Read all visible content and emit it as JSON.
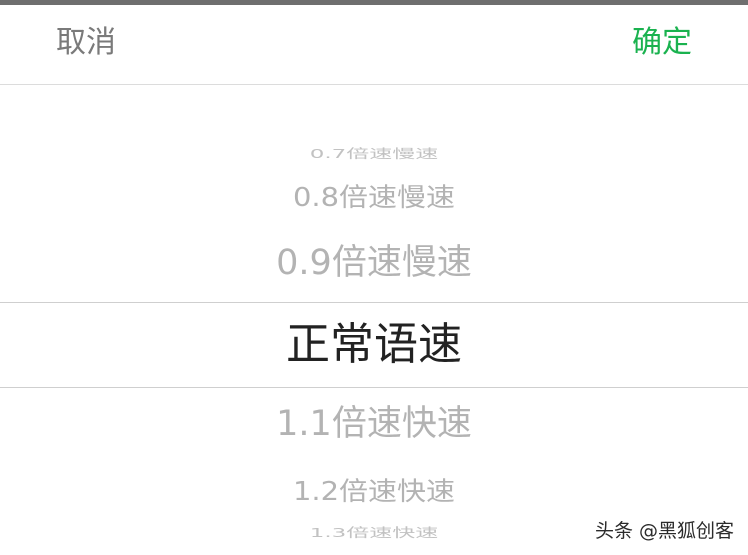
{
  "header": {
    "cancel_label": "取消",
    "confirm_label": "确定",
    "confirm_color": "#1ab24f"
  },
  "picker": {
    "options": [
      {
        "label": "0.7倍速慢速"
      },
      {
        "label": "0.8倍速慢速"
      },
      {
        "label": "0.9倍速慢速"
      },
      {
        "label": "正常语速",
        "selected": true
      },
      {
        "label": "1.1倍速快速"
      },
      {
        "label": "1.2倍速快速"
      },
      {
        "label": "1.3倍速快速"
      }
    ]
  },
  "watermark": {
    "text": "头条 @黑狐创客"
  }
}
